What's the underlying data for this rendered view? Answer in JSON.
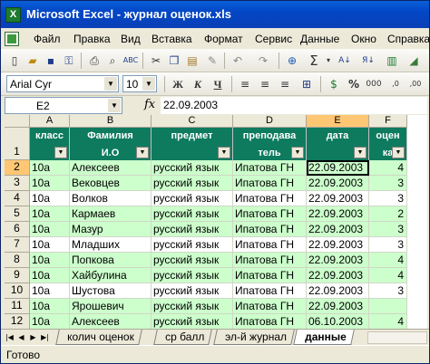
{
  "window": {
    "title": "Microsoft Excel - журнал оценок.xls"
  },
  "menu": [
    "Файл",
    "Правка",
    "Вид",
    "Вставка",
    "Формат",
    "Сервис",
    "Данные",
    "Окно",
    "Справка"
  ],
  "toolbar": {
    "font_name": "Arial Cyr",
    "font_size": "10",
    "bold": "Ж",
    "italic": "К",
    "underline": "Ч",
    "percent": "%",
    "sigma": "Σ"
  },
  "formula_bar": {
    "name_box": "E2",
    "fx": "fx",
    "value": "22.09.2003"
  },
  "columns": [
    "A",
    "B",
    "C",
    "D",
    "E",
    "F"
  ],
  "headers": [
    {
      "line1": "класс",
      "line2": ""
    },
    {
      "line1": "Фамилия",
      "line2": "И.О"
    },
    {
      "line1": "предмет",
      "line2": ""
    },
    {
      "line1": "преподава",
      "line2": "тель"
    },
    {
      "line1": "дата",
      "line2": ""
    },
    {
      "line1": "оцен",
      "line2": "ка"
    }
  ],
  "row_numbers": [
    "1",
    "2",
    "3",
    "4",
    "5",
    "6",
    "7",
    "8",
    "9",
    "10",
    "11",
    "12"
  ],
  "rows": [
    {
      "class": "10а",
      "name": "Алексеев",
      "subject": "русский язык",
      "teacher": "Ипатова ГН",
      "date": "22.09.2003",
      "grade": "4"
    },
    {
      "class": "10а",
      "name": "Вековцев",
      "subject": "русский язык",
      "teacher": "Ипатова ГН",
      "date": "22.09.2003",
      "grade": "3"
    },
    {
      "class": "10а",
      "name": "Волков",
      "subject": "русский язык",
      "teacher": "Ипатова ГН",
      "date": "22.09.2003",
      "grade": "3"
    },
    {
      "class": "10а",
      "name": "Кармаев",
      "subject": "русский язык",
      "teacher": "Ипатова ГН",
      "date": "22.09.2003",
      "grade": "2"
    },
    {
      "class": "10а",
      "name": "Мазур",
      "subject": "русский язык",
      "teacher": "Ипатова ГН",
      "date": "22.09.2003",
      "grade": "3"
    },
    {
      "class": "10а",
      "name": "Младших",
      "subject": "русский язык",
      "teacher": "Ипатова ГН",
      "date": "22.09.2003",
      "grade": "3"
    },
    {
      "class": "10а",
      "name": "Попкова",
      "subject": "русский язык",
      "teacher": "Ипатова ГН",
      "date": "22.09.2003",
      "grade": "4"
    },
    {
      "class": "10а",
      "name": "Хайбулина",
      "subject": "русский язык",
      "teacher": "Ипатова ГН",
      "date": "22.09.2003",
      "grade": "4"
    },
    {
      "class": "10а",
      "name": "Шустова",
      "subject": "русский язык",
      "teacher": "Ипатова ГН",
      "date": "22.09.2003",
      "grade": "3"
    },
    {
      "class": "10а",
      "name": "Ярошевич",
      "subject": "русский язык",
      "teacher": "Ипатова ГН",
      "date": "22.09.2003",
      "grade": ""
    },
    {
      "class": "10а",
      "name": "Алексеев",
      "subject": "русский язык",
      "teacher": "Ипатова ГН",
      "date": "06.10.2003",
      "grade": "4"
    }
  ],
  "sheet_tabs": [
    "колич оценок",
    "ср балл",
    "эл-й журнал",
    "данные"
  ],
  "active_tab": "данные",
  "status": "Готово",
  "colors": {
    "header_bg": "#0e7b5e",
    "band_green": "#ccffcc",
    "selection": "#ffc773"
  }
}
